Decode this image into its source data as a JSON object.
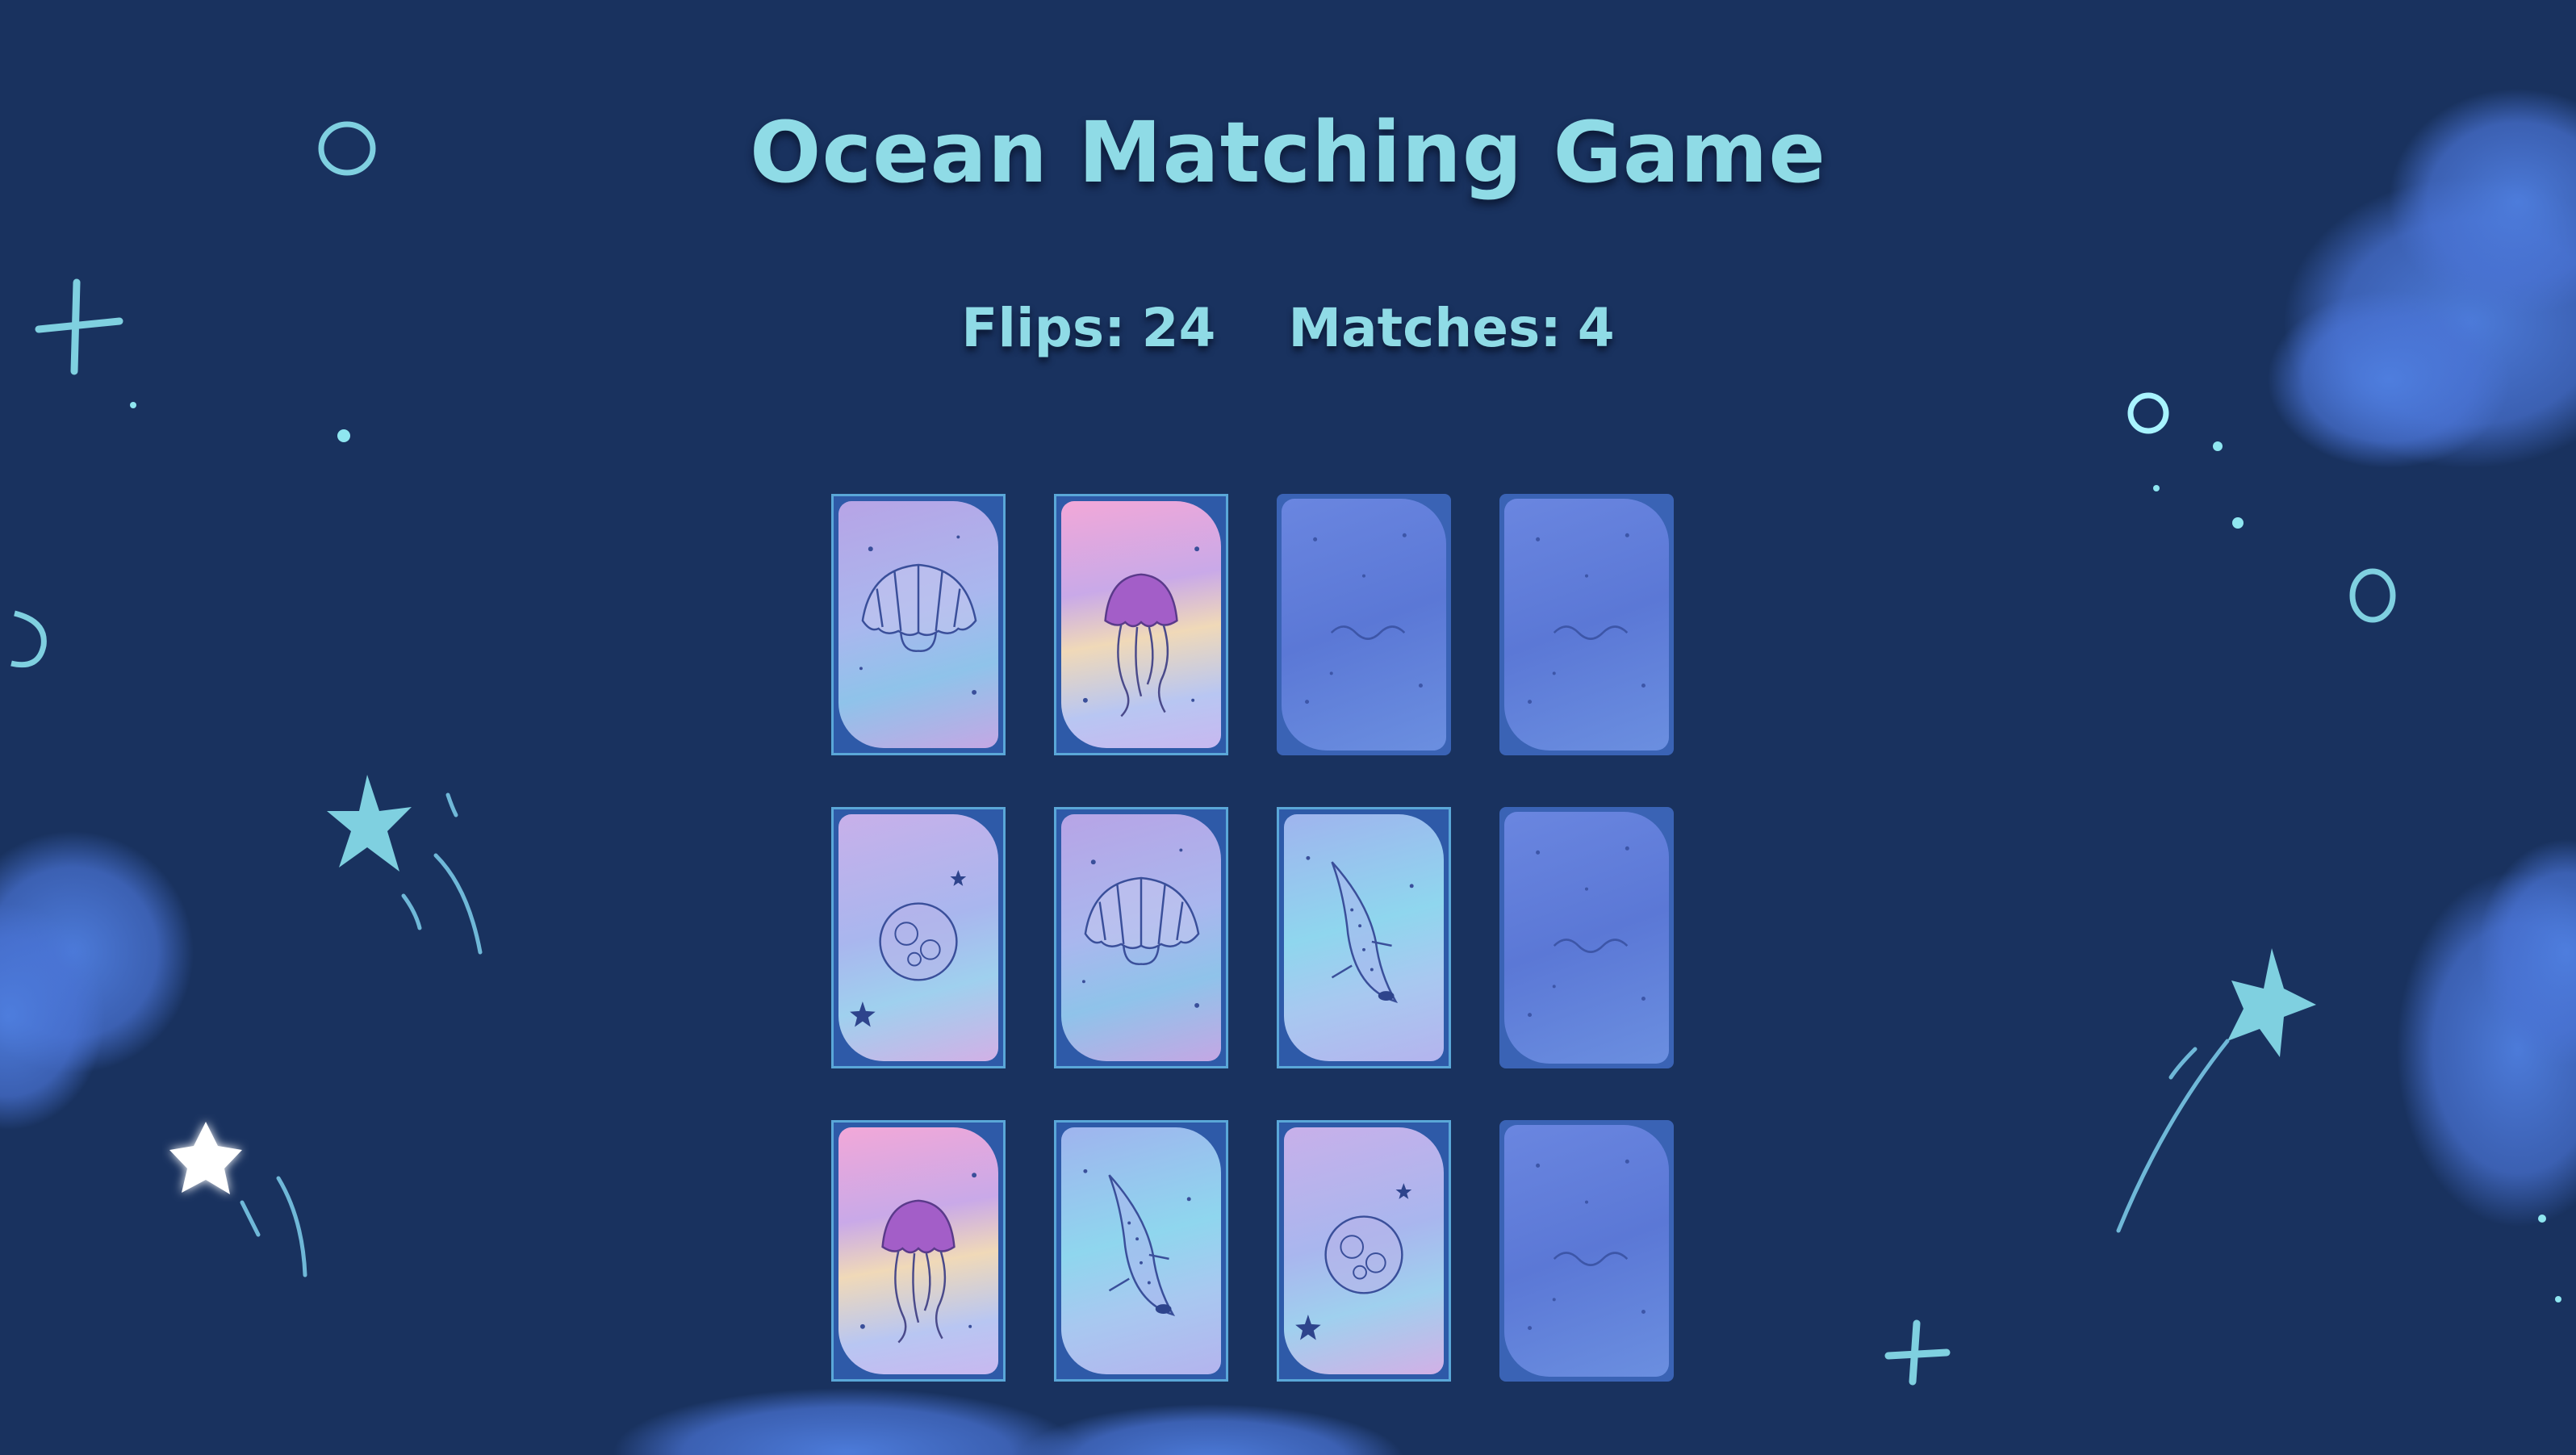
{
  "title": "Ocean Matching Game",
  "stats": {
    "flips_label": "Flips:",
    "flips_value": "24",
    "matches_label": "Matches:",
    "matches_value": "4"
  },
  "colors": {
    "background": "#19325f",
    "accent": "#8fdbe6",
    "card_back": "#5b78d6",
    "card_border": "#5aa7d8"
  },
  "cards": [
    {
      "state": "face-up",
      "image": "seashell"
    },
    {
      "state": "face-up",
      "image": "jellyfish"
    },
    {
      "state": "face-down",
      "image": "card-back"
    },
    {
      "state": "face-down",
      "image": "card-back"
    },
    {
      "state": "face-up",
      "image": "moon"
    },
    {
      "state": "face-up",
      "image": "seashell"
    },
    {
      "state": "face-up",
      "image": "whale-shark"
    },
    {
      "state": "face-down",
      "image": "card-back"
    },
    {
      "state": "face-up",
      "image": "jellyfish"
    },
    {
      "state": "face-up",
      "image": "whale-shark"
    },
    {
      "state": "face-up",
      "image": "moon"
    },
    {
      "state": "face-down",
      "image": "card-back"
    }
  ]
}
